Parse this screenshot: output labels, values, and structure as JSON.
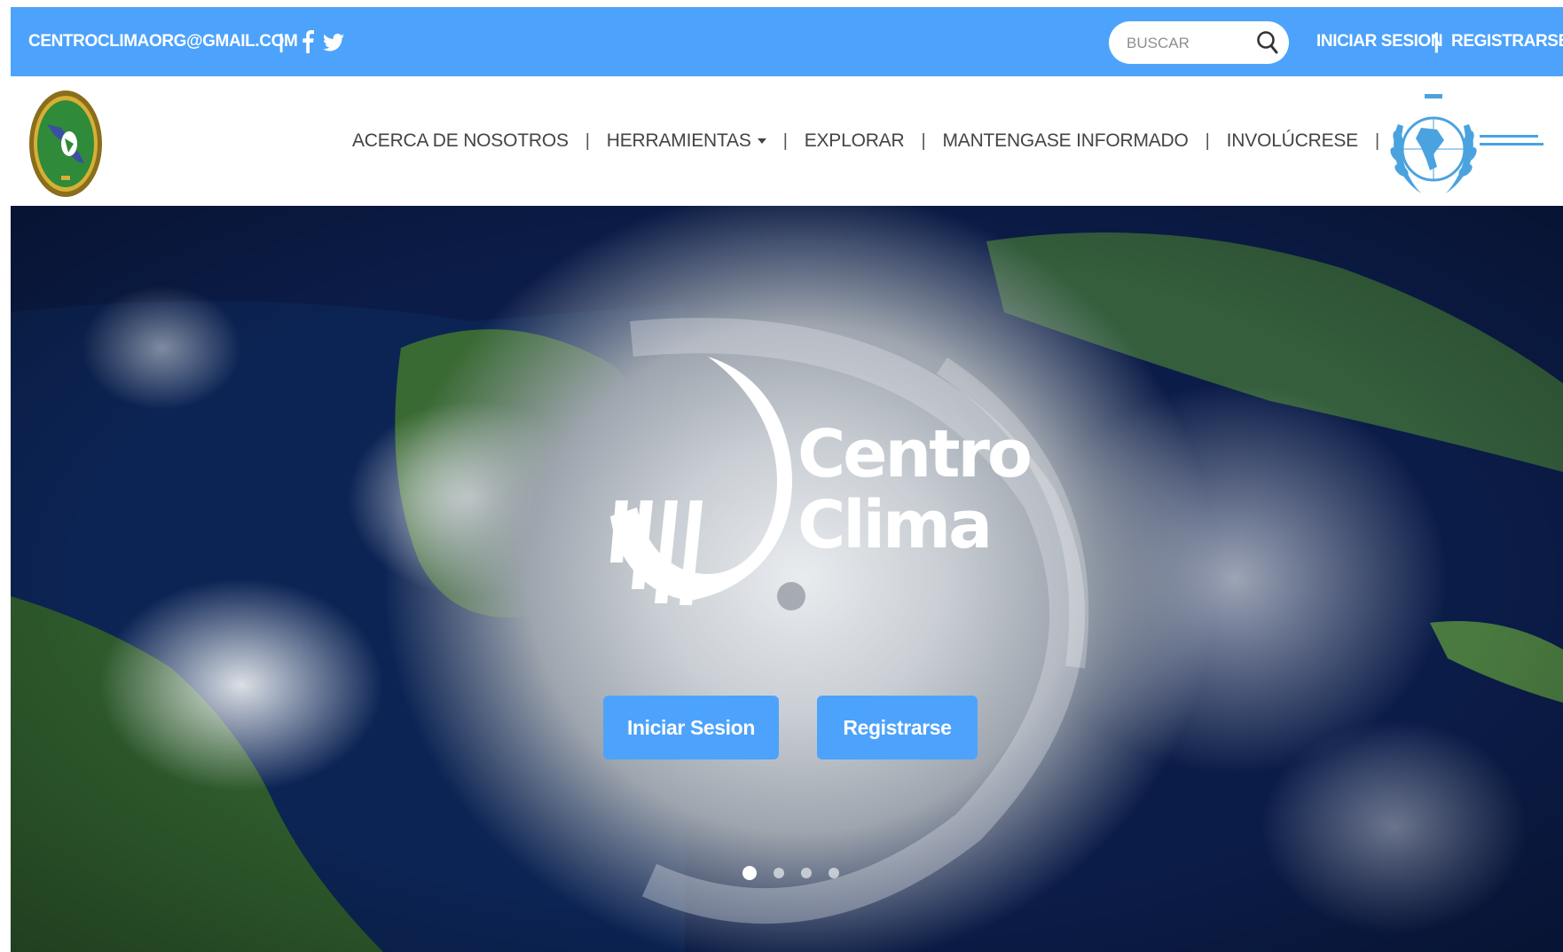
{
  "topbar": {
    "email": "CENTROCLIMAORG@GMAIL.COM",
    "separator": "|",
    "social": [
      "facebook-icon",
      "twitter-icon"
    ],
    "search_placeholder": "BUSCAR",
    "login": "INICIAR SESION",
    "register": "REGISTRARSE",
    "background_color": "#4da3fb"
  },
  "nav": {
    "items": [
      {
        "label": "ACERCA DE NOSOTROS"
      },
      {
        "label": "HERRAMIENTAS",
        "has_dropdown": true
      },
      {
        "label": "EXPLORAR"
      },
      {
        "label": "MANTENGASE INFORMADO"
      },
      {
        "label": "INVOLÚCRESE"
      }
    ],
    "divider": "|",
    "left_logo": "regional-seal-logo",
    "right_logo": "crrh-laurel-logo"
  },
  "hero": {
    "brand_line1": "Centro",
    "brand_line2": "Clima",
    "login_button": "Iniciar Sesion",
    "register_button": "Registrarse",
    "slides_total": 4,
    "active_slide": 1,
    "button_color": "#4da3fb"
  }
}
